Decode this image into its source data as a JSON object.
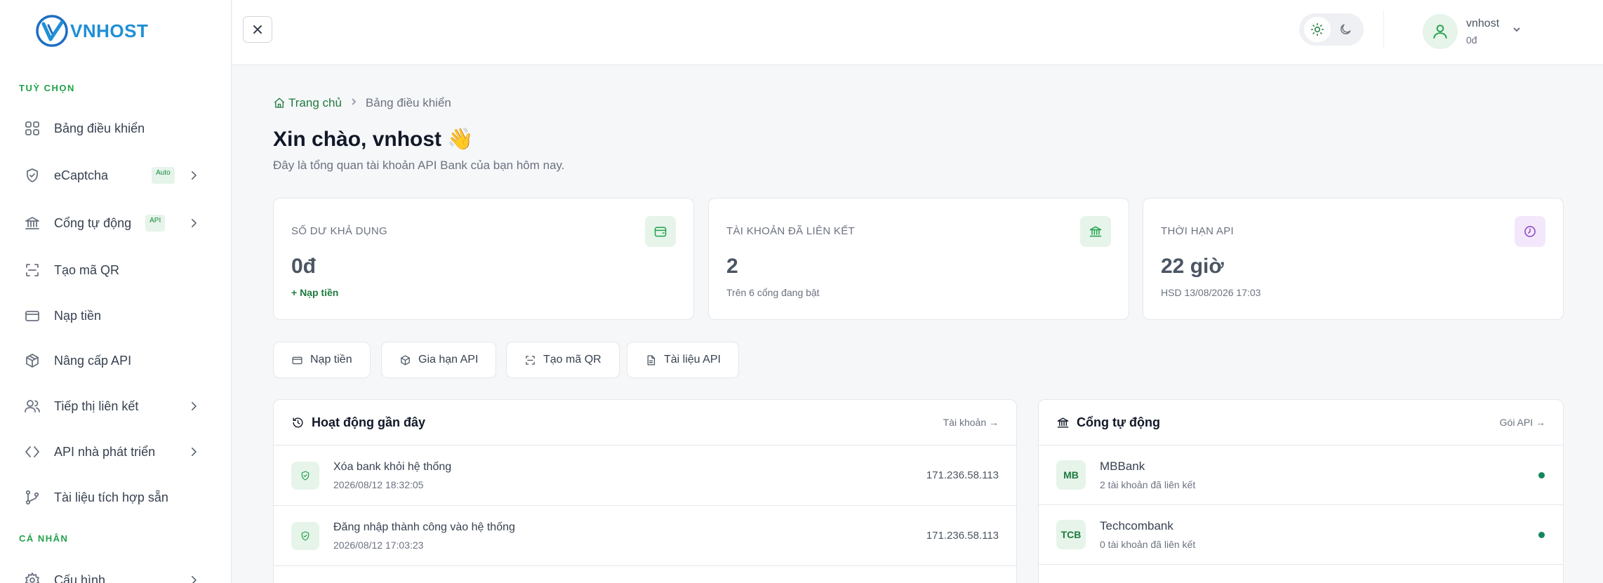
{
  "brand": {
    "name": "VNHOST"
  },
  "sidebar": {
    "section_options": "TUỲ CHỌN",
    "section_personal": "CÁ NHÂN",
    "items": [
      {
        "label": "Bảng điều khiển",
        "icon": "dashboard-icon"
      },
      {
        "label": "eCaptcha",
        "icon": "shield-icon",
        "badge": "Auto"
      },
      {
        "label": "Cổng tự động",
        "icon": "bank-icon",
        "badge": "API"
      },
      {
        "label": "Tạo mã QR",
        "icon": "qr-scan-icon"
      },
      {
        "label": "Nạp tiền",
        "icon": "credit-card-icon"
      },
      {
        "label": "Nâng cấp API",
        "icon": "package-icon"
      },
      {
        "label": "Tiếp thị liên kết",
        "icon": "users-icon"
      },
      {
        "label": "API nhà phát triển",
        "icon": "code-icon"
      },
      {
        "label": "Tài liệu tích hợp sẵn",
        "icon": "git-branch-icon"
      },
      {
        "label": "Cấu hình",
        "icon": "gear-icon"
      }
    ]
  },
  "header": {
    "user": {
      "name": "vnhost",
      "balance": "0đ"
    }
  },
  "breadcrumb": {
    "home": "Trang chủ",
    "current": "Bảng điều khiển"
  },
  "page": {
    "title": "Xin chào, vnhost 👋",
    "subtitle": "Đây là tổng quan tài khoản API Bank của bạn hôm nay."
  },
  "stats": [
    {
      "label": "SỐ DƯ KHẢ DỤNG",
      "value": "0đ",
      "foot": "+ Nạp tiền",
      "icon": "wallet-icon",
      "icon_bg": "#e6f4ea",
      "icon_color": "#22a24a"
    },
    {
      "label": "TÀI KHOẢN ĐÃ LIÊN KẾT",
      "value": "2",
      "foot": "Trên 6 cổng đang bật",
      "icon": "bank-icon",
      "icon_bg": "#e6f4ea",
      "icon_color": "#22a24a"
    },
    {
      "label": "THỜI HẠN API",
      "value": "22 giờ",
      "foot": "HSD 13/08/2026 17:03",
      "icon": "clock-icon",
      "icon_bg": "#f3e8fb",
      "icon_color": "#8b3fc1"
    }
  ],
  "quick_actions": [
    {
      "label": "Nạp tiền",
      "icon": "credit-card-icon"
    },
    {
      "label": "Gia hạn API",
      "icon": "package-icon"
    },
    {
      "label": "Tạo mã QR",
      "icon": "qr-scan-icon"
    },
    {
      "label": "Tài liệu API",
      "icon": "document-icon"
    }
  ],
  "activity": {
    "title": "Hoạt động gần đây",
    "link": "Tài khoản →",
    "items": [
      {
        "title": "Xóa bank khỏi hệ thống",
        "time": "2026/08/12 18:32:05",
        "ip": "171.236.58.113"
      },
      {
        "title": "Đăng nhập thành công vào hệ thống",
        "time": "2026/08/12 17:03:23",
        "ip": "171.236.58.113"
      }
    ]
  },
  "gateways": {
    "title": "Cổng tự động",
    "link": "Gói API →",
    "items": [
      {
        "code": "MB",
        "name": "MBBank",
        "sub": "2 tài khoản đã liên kết",
        "status_color": "#12875a"
      },
      {
        "code": "TCB",
        "name": "Techcombank",
        "sub": "0 tài khoản đã liên kết",
        "status_color": "#12875a"
      }
    ]
  }
}
